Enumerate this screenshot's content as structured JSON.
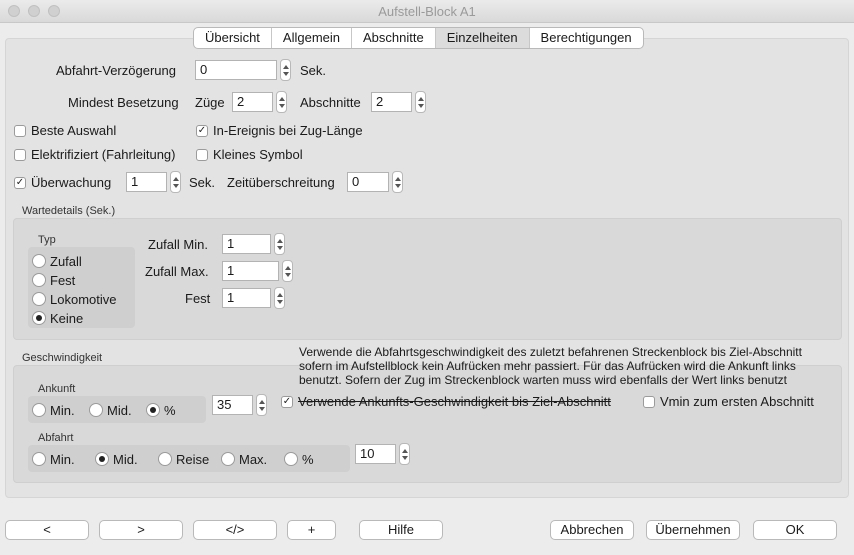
{
  "window": {
    "title": "Aufstell-Block A1"
  },
  "tabs": [
    "Übersicht",
    "Allgemein",
    "Abschnitte",
    "Einzelheiten",
    "Berechtigungen"
  ],
  "form": {
    "abfahrt_label": "Abfahrt-Verzögerung",
    "abfahrt_value": "0",
    "sek": "Sek.",
    "mindest_label": "Mindest Besetzung",
    "zuege_label": "Züge",
    "zuege_value": "2",
    "abschnitte_label": "Abschnitte",
    "abschnitte_value": "2",
    "beste": "Beste Auswahl",
    "inereignis": "In-Ereignis bei Zug-Länge",
    "elektrifiziert": "Elektrifiziert (Fahrleitung)",
    "kleines": "Kleines Symbol",
    "ueberwachung": "Überwachung",
    "ueberwachung_value": "1",
    "zeit_label": "Zeitüberschreitung",
    "zeit_value": "0"
  },
  "warte": {
    "title": "Wartedetails (Sek.)",
    "typ": "Typ",
    "options": [
      "Zufall",
      "Fest",
      "Lokomotive",
      "Keine"
    ],
    "zufall_min_label": "Zufall Min.",
    "zufall_min_value": "1",
    "zufall_max_label": "Zufall Max.",
    "zufall_max_value": "1",
    "fest_label": "Fest",
    "fest_value": "1"
  },
  "geschw": {
    "title": "Geschwindigkeit",
    "note1": "Verwende die Abfahrtsgeschwindigkeit des zuletzt befahrenen Streckenblock bis Ziel-Abschnitt",
    "note2": "sofern im Aufstellblock kein Aufrücken mehr passiert. Für das Aufrücken wird die Ankunft links",
    "note3": "benutzt. Sofern der Zug im Streckenblock warten muss wird ebenfalls der Wert links benutzt",
    "ankunft": "Ankunft",
    "ankunft_options": [
      "Min.",
      "Mid.",
      "%"
    ],
    "ankunft_value": "35",
    "verwende": "Verwende Ankunfts-Geschwindigkeit bis Ziel-Abschnitt",
    "vmin": "Vmin zum ersten Abschnitt",
    "abfahrt": "Abfahrt",
    "abfahrt_options": [
      "Min.",
      "Mid.",
      "Reise",
      "Max.",
      "%"
    ],
    "abfahrt_value": "10"
  },
  "buttons": {
    "prev": "<",
    "next": ">",
    "code": "</>",
    "plus": "+",
    "hilfe": "Hilfe",
    "abbrechen": "Abbrechen",
    "uebernehmen": "Übernehmen",
    "ok": "OK"
  }
}
